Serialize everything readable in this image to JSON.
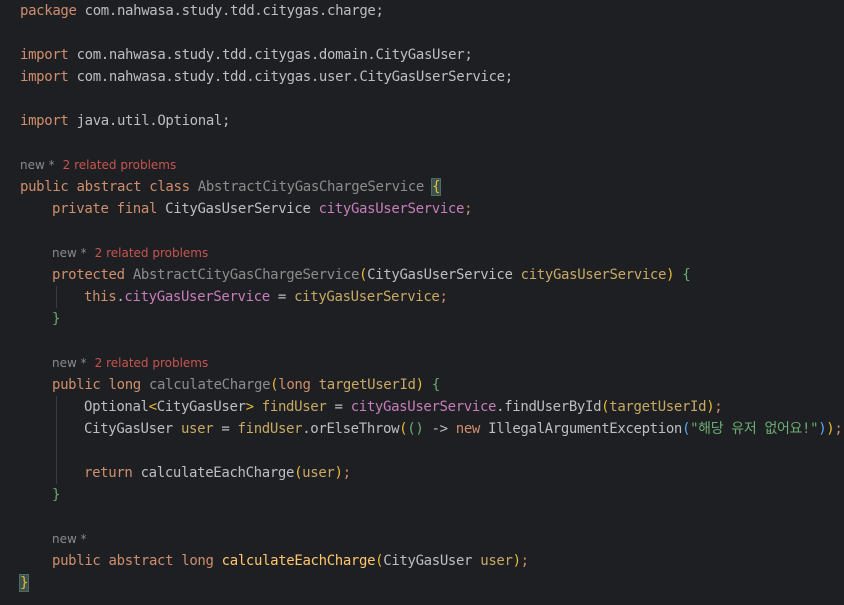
{
  "code": {
    "package_kw": "package",
    "package_name": " com.nahwasa.study.tdd.citygas.charge;",
    "import_kw": "import",
    "import1": " com.nahwasa.study.tdd.citygas.domain.CityGasUser;",
    "import2": " com.nahwasa.study.tdd.citygas.user.CityGasUserService;",
    "import3": " java.util.Optional;",
    "class_mods": "public abstract class",
    "class_name": "AbstractCityGasChargeService",
    "field_mods": "private final",
    "field_type": "CityGasUserService",
    "field_name": "cityGasUserService",
    "ctor_mod": "protected",
    "ctor_name": "AbstractCityGasChargeService",
    "param_type": "CityGasUserService",
    "param_name": "cityGasUserService",
    "this_kw": "this",
    "assign_field": "cityGasUserService",
    "assign_value": "cityGasUserService",
    "method1_mods": "public long",
    "method1_name": "calculateCharge",
    "m1_param_kw": "long",
    "m1_param_name": "targetUserId",
    "optional_type": "Optional",
    "generic_type": "CityGasUser",
    "find_user_var": "findUser",
    "service_ref": "cityGasUserService",
    "find_by_id": "findUserById",
    "target_user_id": "targetUserId",
    "user_type": "CityGasUser",
    "user_var": "user",
    "find_user_ref": "findUser",
    "or_else_throw": "orElseThrow",
    "arrow": "() ->",
    "new_kw": "new",
    "exception": "IllegalArgumentException",
    "message": "\"해당 유저 없어요!\"",
    "return_kw": "return",
    "each_charge_call": "calculateEachCharge",
    "user_arg": "user",
    "method2_mods": "public abstract long",
    "method2_name": "calculateEachCharge",
    "m2_param_type": "CityGasUser",
    "m2_param_name": "user"
  },
  "hints": {
    "new_label": "new *",
    "problems_label": "2 related problems"
  }
}
